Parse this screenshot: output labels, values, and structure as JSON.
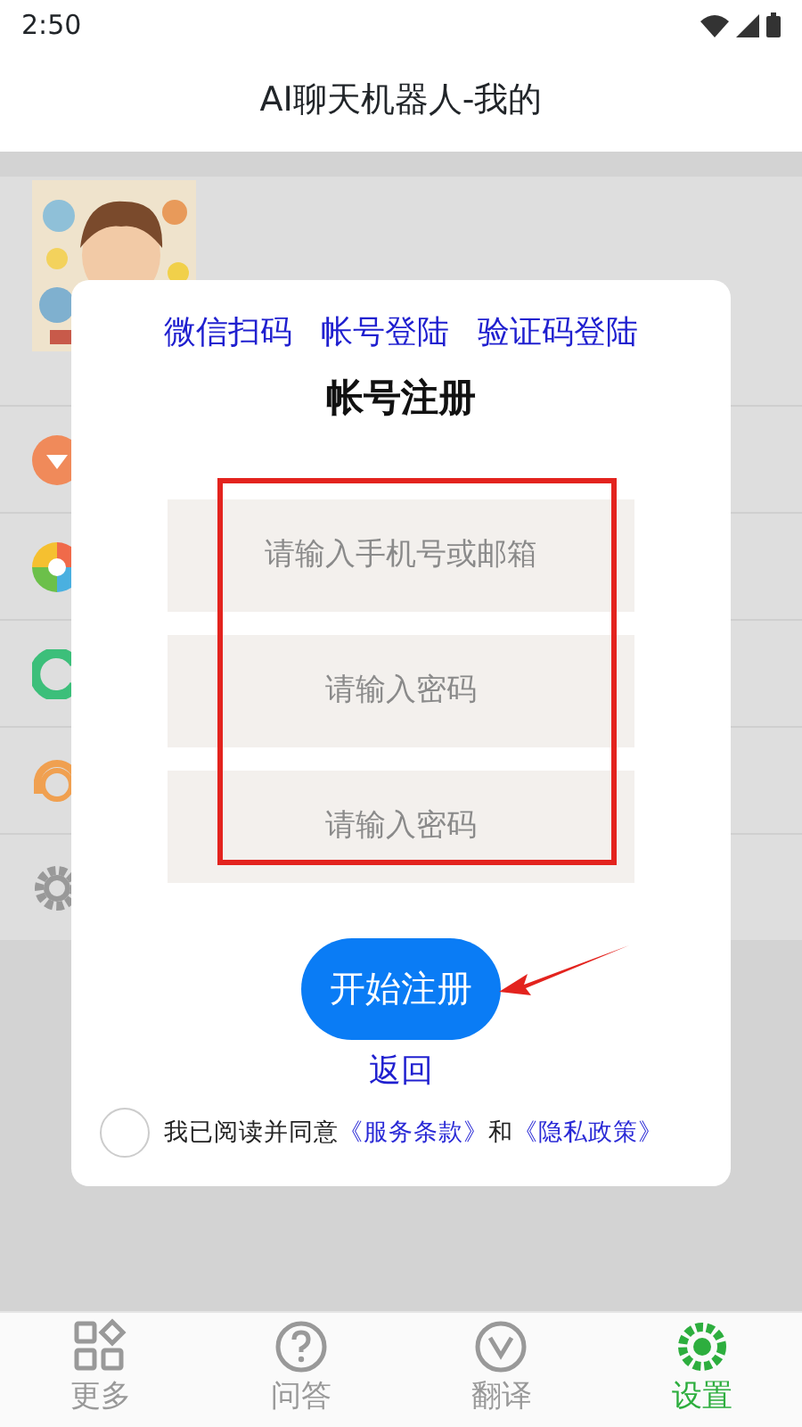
{
  "status_bar": {
    "time": "2:50"
  },
  "header": {
    "title": "AI聊天机器人-我的"
  },
  "dialog": {
    "tabs": [
      {
        "label": "微信扫码"
      },
      {
        "label": "帐号登陆"
      },
      {
        "label": "验证码登陆"
      }
    ],
    "title": "帐号注册",
    "fields": [
      {
        "placeholder": "请输入手机号或邮箱"
      },
      {
        "placeholder": "请输入密码"
      },
      {
        "placeholder": "请输入密码"
      }
    ],
    "submit": "开始注册",
    "back": "返回",
    "agreement": {
      "checked": false,
      "text": "我已阅读并同意",
      "terms": "《服务条款》",
      "joiner": "和",
      "privacy": "《隐私政策》"
    }
  },
  "bottom_nav": [
    {
      "kind": "grid",
      "label": "更多",
      "selected": false
    },
    {
      "kind": "help",
      "label": "问答",
      "selected": false
    },
    {
      "kind": "translate",
      "label": "翻译",
      "selected": false
    },
    {
      "kind": "settings",
      "label": "设置",
      "selected": true
    }
  ]
}
